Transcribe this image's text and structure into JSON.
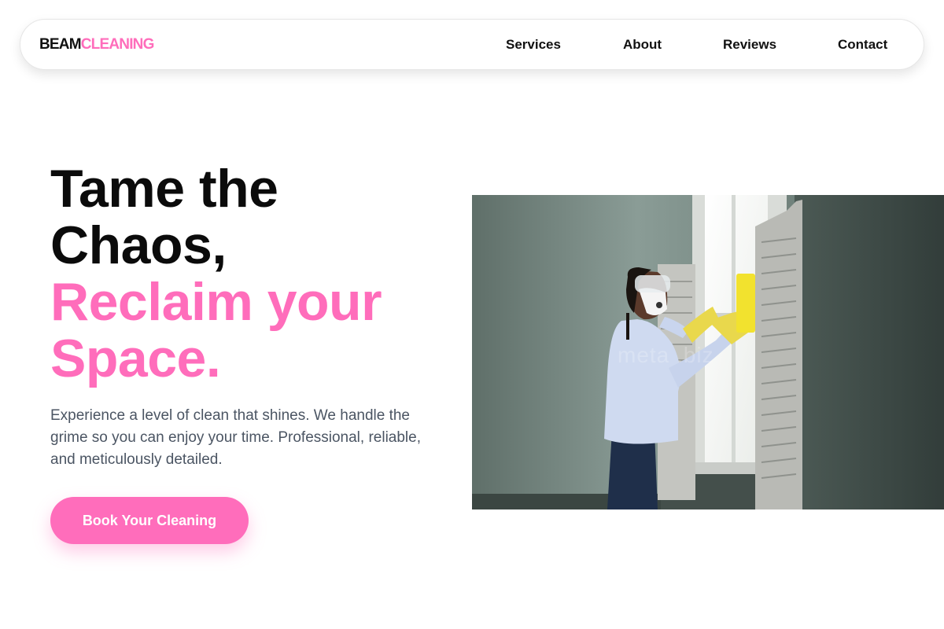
{
  "brand": {
    "logo_part1": "BEAM",
    "logo_part2": "CLEANING",
    "accent_color": "#ff6dbb"
  },
  "nav": {
    "items": [
      {
        "label": "Services"
      },
      {
        "label": "About"
      },
      {
        "label": "Reviews"
      },
      {
        "label": "Contact"
      }
    ]
  },
  "hero": {
    "title_line1": "Tame the",
    "title_line2": "Chaos,",
    "title_line3": "Reclaim your",
    "title_line4": "Space.",
    "description": "Experience a level of clean that shines. We handle the grime so you can enjoy your time. Professional, reliable, and meticulously detailed.",
    "cta_label": "Book Your Cleaning",
    "image": {
      "alt": "Cleaner wearing a mask and goggles wiping a window with a yellow sponge",
      "watermark": "meta     .biz"
    }
  }
}
